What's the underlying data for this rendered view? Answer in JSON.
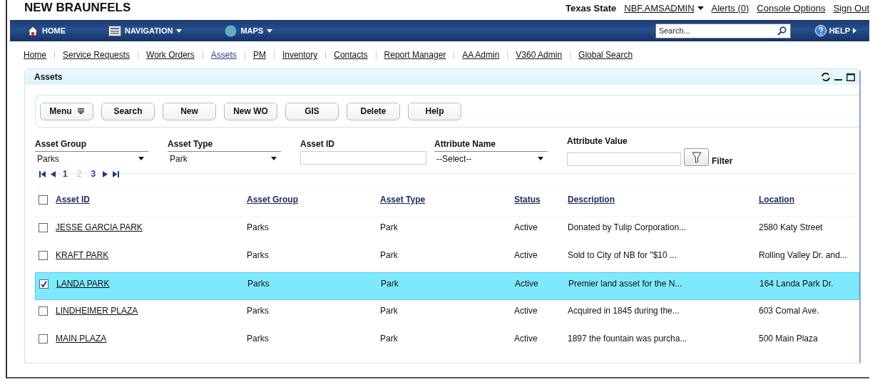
{
  "header": {
    "title": "NEW BRAUNFELS",
    "org": "Texas State",
    "user": "NBF.AMSADMIN",
    "links": [
      "Alerts (0)",
      "Console Options",
      "Sign Out"
    ]
  },
  "navbar": {
    "items": [
      {
        "kind": "home",
        "label": "HOME"
      },
      {
        "kind": "navigation",
        "label": "NAVIGATION"
      },
      {
        "kind": "maps",
        "label": "MAPS"
      }
    ],
    "search": {
      "placeholder": "Search..."
    },
    "help": "HELP"
  },
  "links": [
    {
      "label": "Home",
      "selected": false
    },
    {
      "label": "Service Requests",
      "selected": false
    },
    {
      "label": "Work Orders",
      "selected": false
    },
    {
      "label": "Assets",
      "selected": true
    },
    {
      "label": "PM",
      "selected": false
    },
    {
      "label": "Inventory",
      "selected": false
    },
    {
      "label": "Contacts",
      "selected": false
    },
    {
      "label": "Report Manager",
      "selected": false
    },
    {
      "label": "AA Admin",
      "selected": false
    },
    {
      "label": "V360 Admin",
      "selected": false
    },
    {
      "label": "Global Search",
      "selected": false
    }
  ],
  "panel": {
    "title": "Assets",
    "toolbar": [
      "Menu",
      "Search",
      "New",
      "New WO",
      "GIS",
      "Delete",
      "Help"
    ],
    "filters": [
      {
        "kind": "select",
        "label": "Asset Group",
        "value": "Parks"
      },
      {
        "kind": "select",
        "label": "Asset Type",
        "value": "Park"
      },
      {
        "kind": "text",
        "label": "Asset ID"
      },
      {
        "kind": "select",
        "label": "Attribute Name",
        "value": "--Select--"
      },
      {
        "kind": "text",
        "label": "Attribute Value"
      }
    ],
    "filter_button": "Filter",
    "pages": [
      {
        "label": "1",
        "selected": false
      },
      {
        "label": "2",
        "selected": true
      },
      {
        "label": "3",
        "selected": false
      }
    ],
    "table": {
      "columns": [
        "Asset ID",
        "Asset Group",
        "Asset Type",
        "Status",
        "Description",
        "Location"
      ],
      "all_checked": false,
      "rows": [
        {
          "checked": false,
          "selected": false,
          "cells": [
            "JESSE GARCIA PARK",
            "Parks",
            "Park",
            "Active",
            "Donated by Tulip Corporation...",
            "2580 Katy Street"
          ]
        },
        {
          "checked": false,
          "selected": false,
          "cells": [
            "KRAFT PARK",
            "Parks",
            "Park",
            "Active",
            "Sold to City of NB for \"$10 ...",
            "Rolling Valley Dr. and..."
          ]
        },
        {
          "checked": true,
          "selected": true,
          "cells": [
            "LANDA PARK",
            "Parks",
            "Park",
            "Active",
            "Premier land asset for the N...",
            "164 Landa Park Dr."
          ]
        },
        {
          "checked": false,
          "selected": false,
          "cells": [
            "LINDHEIMER PLAZA",
            "Parks",
            "Park",
            "Active",
            "Acquired in 1845 during the...",
            "603 Comal Ave."
          ]
        },
        {
          "checked": false,
          "selected": false,
          "cells": [
            "MAIN PLAZA",
            "Parks",
            "Park",
            "Active",
            "1897 the fountain was purcha...",
            "500 Main Plaza"
          ]
        }
      ]
    }
  }
}
